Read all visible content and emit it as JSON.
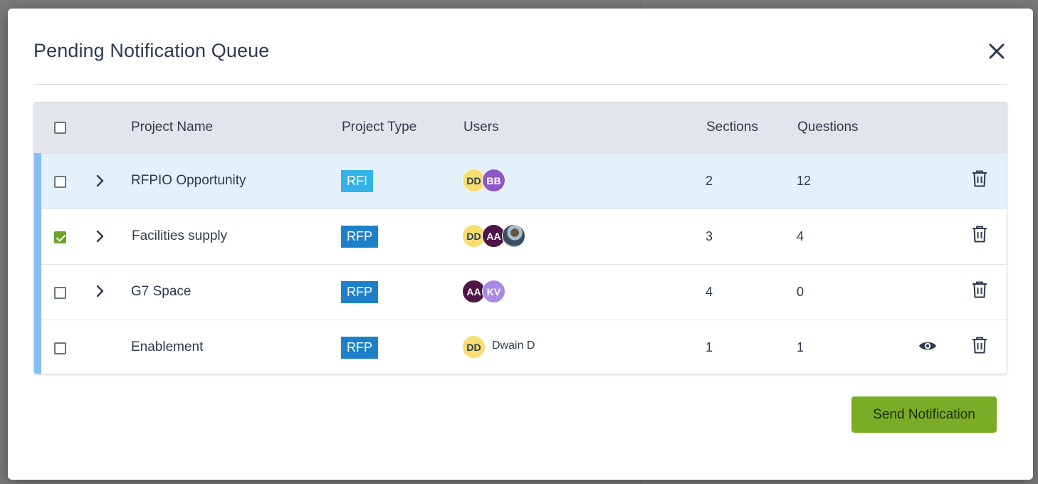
{
  "modal": {
    "title": "Pending Notification Queue"
  },
  "table": {
    "headers": {
      "project_name": "Project Name",
      "project_type": "Project Type",
      "users": "Users",
      "sections": "Sections",
      "questions": "Questions"
    },
    "rows": [
      {
        "name": "RFPIO Opportunity",
        "type": "RFI",
        "type_color": "#33b2e8",
        "users": [
          {
            "initials": "DD",
            "color": "#f7de70"
          },
          {
            "initials": "BB",
            "color": "#8e57c6"
          }
        ],
        "sections": "2",
        "questions": "12",
        "checked": false,
        "highlighted": true
      },
      {
        "name": "Facilities supply",
        "type": "RFP",
        "type_color": "#1e80c8",
        "users": [
          {
            "initials": "DD",
            "color": "#f7de70"
          },
          {
            "initials": "AA",
            "color": "#4c1646"
          },
          {
            "initials": "",
            "color": "photo"
          }
        ],
        "sections": "3",
        "questions": "4",
        "checked": true,
        "highlighted": false
      },
      {
        "name": "G7 Space",
        "type": "RFP",
        "type_color": "#1e80c8",
        "users": [
          {
            "initials": "AA",
            "color": "#4c1646"
          },
          {
            "initials": "KV",
            "color": "#a989e6"
          }
        ],
        "sections": "4",
        "questions": "0",
        "checked": false,
        "highlighted": false
      },
      {
        "name": "Enablement",
        "type": "RFP",
        "type_color": "#1e80c8",
        "users": [
          {
            "initials": "DD",
            "color": "#f7de70",
            "name": "Dwain D"
          }
        ],
        "sections": "1",
        "questions": "1",
        "checked": false,
        "highlighted": false
      }
    ]
  },
  "footer": {
    "send_label": "Send Notification"
  },
  "colors": {
    "accent_green": "#79ad25",
    "row_highlight": "#e4f1fb",
    "row_marker": "#86bdf2"
  },
  "icons": {
    "close": "close-icon",
    "chevron": "chevron-right-icon",
    "delete": "trash-icon",
    "view": "eye-icon"
  }
}
